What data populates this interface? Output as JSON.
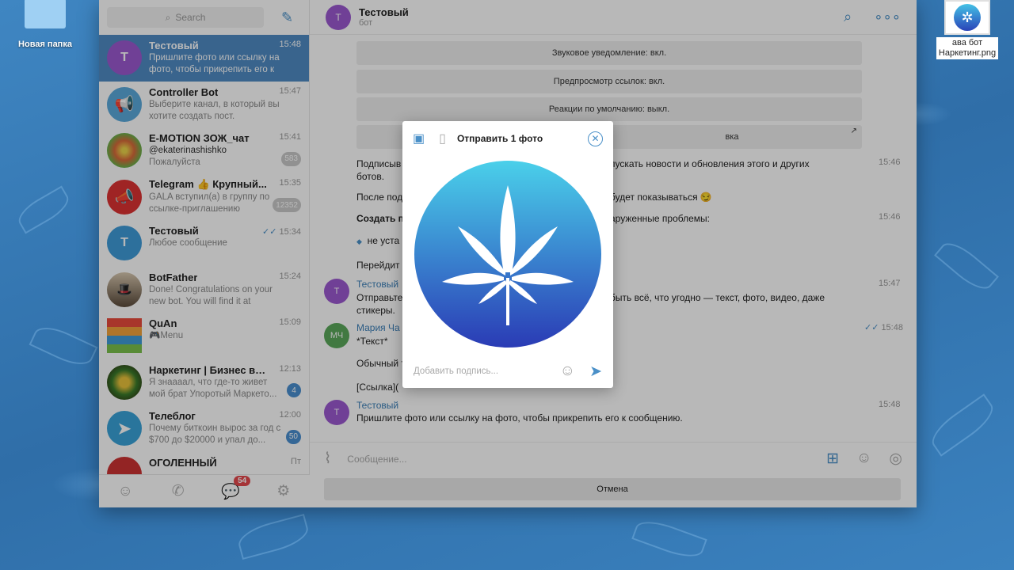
{
  "desktop": {
    "folder_label": "Новая папка",
    "file_label_line1": "ава бот",
    "file_label_line2": "Наркетинг.png"
  },
  "sidebar": {
    "search_placeholder": "Search",
    "chats": [
      {
        "name": "Тестовый",
        "time": "15:48",
        "preview": "Пришлите фото или ссылку на фото, чтобы прикрепить его к с...",
        "avatar_letter": "Т",
        "avatar_color": "#9b59d0",
        "active": true
      },
      {
        "name": "Controller Bot",
        "time": "15:47",
        "preview": "Выберите канал, в который вы хотите создать пост.",
        "avatar_letter": "",
        "avatar_color": "#5aa9dc"
      },
      {
        "name": "E-MOTION ЗОЖ_чат",
        "time": "15:41",
        "preview_line1": "@ekaterinashishko",
        "preview_line2": "Пожалуйста",
        "badge": "583",
        "avatar_color": "#c06a3b"
      },
      {
        "name": "Telegram 👍 Крупный...",
        "time": "15:35",
        "preview": "GALA вступил(а) в группу по ссылке-приглашению",
        "badge": "12352",
        "avatar_color": "#d33"
      },
      {
        "name": "Тестовый",
        "time": "15:34",
        "preview": "Любое сообщение",
        "avatar_letter": "Т",
        "avatar_color": "#3f9bd9"
      },
      {
        "name": "BotFather",
        "time": "15:24",
        "preview": "Done! Congratulations on your new bot. You will find it at t.me/Testov...",
        "avatar_color": "#8a6a4a"
      },
      {
        "name": "QuAn",
        "time": "15:09",
        "preview": "🎮Menu",
        "avatar_color": "#e9a23b"
      },
      {
        "name": "Наркетинг | Бизнес в Те...",
        "time": "12:13",
        "preview": "Я знаааал, что где-то живет мой брат Упоротый Маркето...",
        "badge": "4",
        "avatar_color": "#3a2a1a"
      },
      {
        "name": "Телеблог",
        "time": "12:00",
        "preview": "Почему биткоин вырос за год с $700 до $20000 и упал до...",
        "badge": "50",
        "avatar_color": "#3aa3d8"
      },
      {
        "name": "ОГОЛЕННЫЙ",
        "time": "Пт",
        "preview": "",
        "avatar_color": "#c33"
      }
    ],
    "nav_badge": "54"
  },
  "chat": {
    "title": "Тестовый",
    "subtitle": "бот",
    "service_1": "Звуковое уведомление: вкл.",
    "service_2": "Предпросмотр ссылок: вкл.",
    "service_3": "Реакции по умолчанию: выкл.",
    "service_4_tail": "вка",
    "msg_a_line1": "Подписыв",
    "msg_a_line1_tail": "пускать новости и обновления этого и других",
    "msg_a_line2": "ботов.",
    "msg_a_time": "15:46",
    "msg_b": "После под",
    "msg_b_tail": "будет показываться 😏",
    "msg_c": "Создать п",
    "msg_c_tail": "аруженные проблемы:",
    "msg_c_time": "15:46",
    "msg_d": "не уста",
    "msg_e": "Перейдит",
    "msg_f_sender": "Тестовый",
    "msg_f_text": "Отправьте",
    "msg_f_tail": "быть всё, что угодно — текст, фото, видео, даже",
    "msg_f_line2": "стикеры.",
    "msg_f_time": "15:47",
    "msg_g_sender": "Мария Ча",
    "msg_g_text": "*Текст*",
    "msg_g_time": "15:48",
    "msg_h": "Обычный т",
    "msg_i": "[Ссылка](",
    "msg_j_sender": "Тестовый",
    "msg_j_text": "Пришлите фото или ссылку на фото, чтобы прикрепить его к сообщению.",
    "msg_j_time": "15:48",
    "avatar_t": "Т",
    "avatar_mch": "МЧ",
    "composer_placeholder": "Сообщение...",
    "cancel_label": "Отмена"
  },
  "modal": {
    "title": "Отправить 1 фото",
    "caption_placeholder": "Добавить подпись..."
  }
}
